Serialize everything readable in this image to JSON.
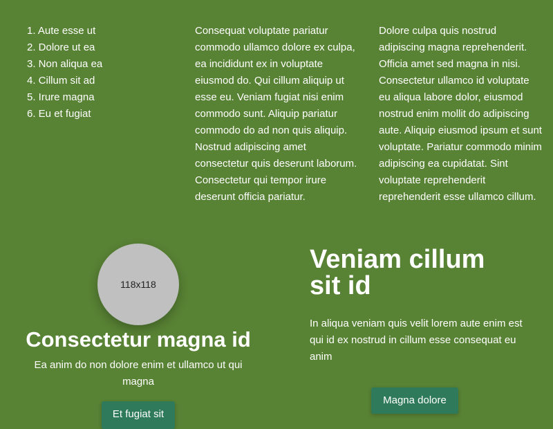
{
  "list": {
    "items": [
      "1. Aute esse ut",
      "2. Dolore ut ea",
      "3. Non aliqua ea",
      "4. Cillum sit ad",
      "5. Irure magna",
      "6. Eu et fugiat"
    ]
  },
  "column2": {
    "text": "Consequat voluptate pariatur commodo ullamco dolore ex culpa, ea incididunt ex in voluptate eiusmod do. Qui cillum aliquip ut esse eu. Veniam fugiat nisi enim commodo sunt. Aliquip pariatur commodo do ad non quis aliquip. Nostrud adipiscing amet consectetur quis deserunt laborum. Consectetur qui tempor irure deserunt officia pariatur."
  },
  "column3": {
    "text": "Dolore culpa quis nostrud adipiscing magna reprehenderit. Officia amet sed magna in nisi. Consectetur ullamco id voluptate eu aliqua labore dolor, eiusmod nostrud enim mollit do adipiscing aute. Aliquip eiusmod ipsum et sunt voluptate. Pariatur commodo minim adipiscing ea cupidatat. Sint voluptate reprehenderit reprehenderit esse ullamco cillum."
  },
  "left_section": {
    "avatar_label": "118x118",
    "title": "Consectetur magna id",
    "text": "Ea anim do non dolore enim et ullamco ut qui magna",
    "button_label": "Et fugiat sit"
  },
  "right_section": {
    "title": "Veniam cillum sit id",
    "text": "In aliqua veniam quis velit lorem aute enim est qui id ex nostrud in cillum esse consequat eu anim",
    "button_label": "Magna dolore"
  },
  "colors": {
    "background": "#588234",
    "button": "#2e7a5a",
    "avatar": "#c0c0c0"
  }
}
